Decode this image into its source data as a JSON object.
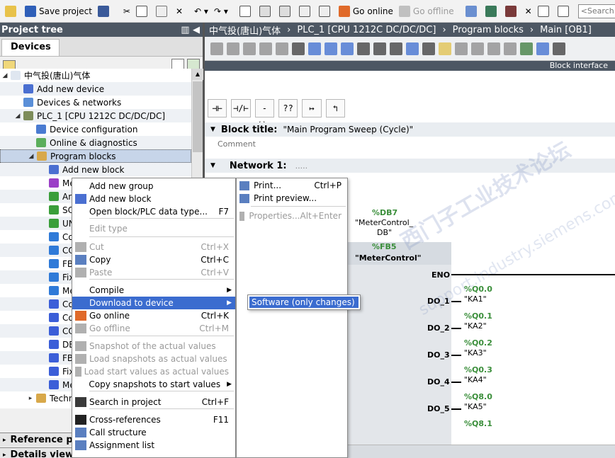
{
  "toolbar": {
    "save_label": "Save project",
    "go_online_label": "Go online",
    "go_offline_label": "Go offline",
    "search_placeholder": "<Search in proj"
  },
  "project_tree": {
    "title": "Project tree",
    "tab": "Devices",
    "items": [
      {
        "label": "中气投(唐山)气体",
        "level": 0,
        "twisty": "◢",
        "icon_color": "#dfe6f0"
      },
      {
        "label": "Add new device",
        "level": 1,
        "twisty": "",
        "icon_color": "#4a6fd1"
      },
      {
        "label": "Devices & networks",
        "level": 1,
        "twisty": "",
        "icon_color": "#5a8fd8"
      },
      {
        "label": "PLC_1 [CPU 1212C DC/DC/DC]",
        "level": 1,
        "twisty": "◢",
        "icon_color": "#7d8c5a"
      },
      {
        "label": "Device configuration",
        "level": 2,
        "twisty": "",
        "icon_color": "#4a7bd1"
      },
      {
        "label": "Online & diagnostics",
        "level": 2,
        "twisty": "",
        "icon_color": "#5cae5c"
      },
      {
        "label": "Program blocks",
        "level": 2,
        "twisty": "◢",
        "icon_color": "#d8a84a"
      },
      {
        "label": "Add new block",
        "level": 3,
        "twisty": "",
        "icon_color": "#4a6fd1"
      },
      {
        "label": "Me",
        "level": 3,
        "twisty": "",
        "icon_color": "#9b3fc7"
      },
      {
        "label": "An",
        "level": 3,
        "twisty": "",
        "icon_color": "#3a9e3a"
      },
      {
        "label": "SC",
        "level": 3,
        "twisty": "",
        "icon_color": "#3a9e3a"
      },
      {
        "label": "UN",
        "level": 3,
        "twisty": "",
        "icon_color": "#3a9e3a"
      },
      {
        "label": "Co",
        "level": 3,
        "twisty": "",
        "icon_color": "#2f7ad8"
      },
      {
        "label": "CO",
        "level": 3,
        "twisty": "",
        "icon_color": "#2f7ad8"
      },
      {
        "label": "FB",
        "level": 3,
        "twisty": "",
        "icon_color": "#2f7ad8"
      },
      {
        "label": "Fix",
        "level": 3,
        "twisty": "",
        "icon_color": "#2f7ad8"
      },
      {
        "label": "Me",
        "level": 3,
        "twisty": "",
        "icon_color": "#2f7ad8"
      },
      {
        "label": "Co",
        "level": 3,
        "twisty": "",
        "icon_color": "#3b5ed8"
      },
      {
        "label": "Co",
        "level": 3,
        "twisty": "",
        "icon_color": "#3b5ed8"
      },
      {
        "label": "CO",
        "level": 3,
        "twisty": "",
        "icon_color": "#3b5ed8"
      },
      {
        "label": "DE",
        "level": 3,
        "twisty": "",
        "icon_color": "#3b5ed8"
      },
      {
        "label": "FB",
        "level": 3,
        "twisty": "",
        "icon_color": "#3b5ed8"
      },
      {
        "label": "Fix",
        "level": 3,
        "twisty": "",
        "icon_color": "#3b5ed8"
      },
      {
        "label": "Me",
        "level": 3,
        "twisty": "",
        "icon_color": "#3b5ed8"
      },
      {
        "label": "Techn",
        "level": 2,
        "twisty": "▸",
        "icon_color": "#d8a84a"
      }
    ],
    "reference_label": "Reference pr",
    "details_label": "Details view"
  },
  "main": {
    "breadcrumb": [
      "中气投(唐山)气体",
      "PLC_1 [CPU 1212C DC/DC/DC]",
      "Program blocks",
      "Main [OB1]"
    ],
    "block_interface_label": "Block interface",
    "block_title_label": "Block title:",
    "block_title_value": "\"Main Program Sweep (Cycle)\"",
    "comment_placeholder": "Comment",
    "network_label": "Network 1:",
    "network_dots": ".....",
    "db_address": "%DB7",
    "db_name_line1": "\"MeterControl_",
    "db_name_line2": "DB\"",
    "fb_address": "%FB5",
    "fb_name": "\"MeterControl\"",
    "eno_label": "ENO",
    "outputs": [
      {
        "pin": "DO_1",
        "addr": "%Q0.0",
        "name": "\"KA1\""
      },
      {
        "pin": "DO_2",
        "addr": "%Q0.1",
        "name": "\"KA2\""
      },
      {
        "pin": "DO_3",
        "addr": "%Q0.2",
        "name": "\"KA3\""
      },
      {
        "pin": "DO_4",
        "addr": "%Q0.3",
        "name": "\"KA4\""
      },
      {
        "pin": "DO_5",
        "addr": "%Q8.0",
        "name": "\"KA5\""
      }
    ],
    "last_addr": "%Q8.1",
    "watermark1": "西门子工业技术论坛",
    "watermark2": "support.industry.siemens.com/cs"
  },
  "context_menu": {
    "items": [
      {
        "label": "Add new group",
        "shortcut": "",
        "icon_color": "",
        "disabled": false,
        "submenu": false
      },
      {
        "label": "Add new block",
        "shortcut": "",
        "icon_color": "#4a6fd1",
        "disabled": false,
        "submenu": false
      },
      {
        "label": "Open block/PLC data type...",
        "shortcut": "F7",
        "icon_color": "",
        "disabled": false,
        "submenu": false
      },
      {
        "label": "Edit type",
        "shortcut": "",
        "icon_color": "",
        "disabled": true,
        "submenu": false
      },
      {
        "label": "Cut",
        "shortcut": "Ctrl+X",
        "icon_color": "#b0b0b0",
        "disabled": true,
        "submenu": false
      },
      {
        "label": "Copy",
        "shortcut": "Ctrl+C",
        "icon_color": "#5a7fc0",
        "disabled": false,
        "submenu": false
      },
      {
        "label": "Paste",
        "shortcut": "Ctrl+V",
        "icon_color": "#b0b0b0",
        "disabled": true,
        "submenu": false
      },
      {
        "label": "Compile",
        "shortcut": "",
        "icon_color": "",
        "disabled": false,
        "submenu": true
      },
      {
        "label": "Download to device",
        "shortcut": "",
        "icon_color": "",
        "disabled": false,
        "submenu": true
      },
      {
        "label": "Go online",
        "shortcut": "Ctrl+K",
        "icon_color": "#e06a2a",
        "disabled": false,
        "submenu": false
      },
      {
        "label": "Go offline",
        "shortcut": "Ctrl+M",
        "icon_color": "#b0b0b0",
        "disabled": true,
        "submenu": false
      },
      {
        "label": "Snapshot of the actual values",
        "shortcut": "",
        "icon_color": "#b0b0b0",
        "disabled": true,
        "submenu": false
      },
      {
        "label": "Load snapshots as actual values",
        "shortcut": "",
        "icon_color": "#b0b0b0",
        "disabled": true,
        "submenu": false
      },
      {
        "label": "Load start values as actual values",
        "shortcut": "",
        "icon_color": "#b0b0b0",
        "disabled": true,
        "submenu": false
      },
      {
        "label": "Copy snapshots to start values",
        "shortcut": "",
        "icon_color": "",
        "disabled": false,
        "submenu": true
      },
      {
        "label": "Search in project",
        "shortcut": "Ctrl+F",
        "icon_color": "#3a3a3a",
        "disabled": false,
        "submenu": false
      },
      {
        "label": "Cross-references",
        "shortcut": "F11",
        "icon_color": "#222",
        "disabled": false,
        "submenu": false
      },
      {
        "label": "Call structure",
        "shortcut": "",
        "icon_color": "#5a7fc0",
        "disabled": false,
        "submenu": false
      },
      {
        "label": "Assignment list",
        "shortcut": "",
        "icon_color": "#5a7fc0",
        "disabled": false,
        "submenu": false
      }
    ],
    "right_column": [
      {
        "label": "Print...",
        "shortcut": "Ctrl+P",
        "icon_color": "#5a7fc0",
        "disabled": false
      },
      {
        "label": "Print preview...",
        "shortcut": "",
        "icon_color": "#5a7fc0",
        "disabled": false
      },
      {
        "label": "Properties...",
        "shortcut": "Alt+Enter",
        "icon_color": "#b0b0b0",
        "disabled": true
      }
    ],
    "submenu_item": "Software (only changes)"
  },
  "colors": {
    "header_bg": "#4d5763",
    "menu_highlight": "#3b6ccf",
    "address_green": "#3a8e3a"
  }
}
